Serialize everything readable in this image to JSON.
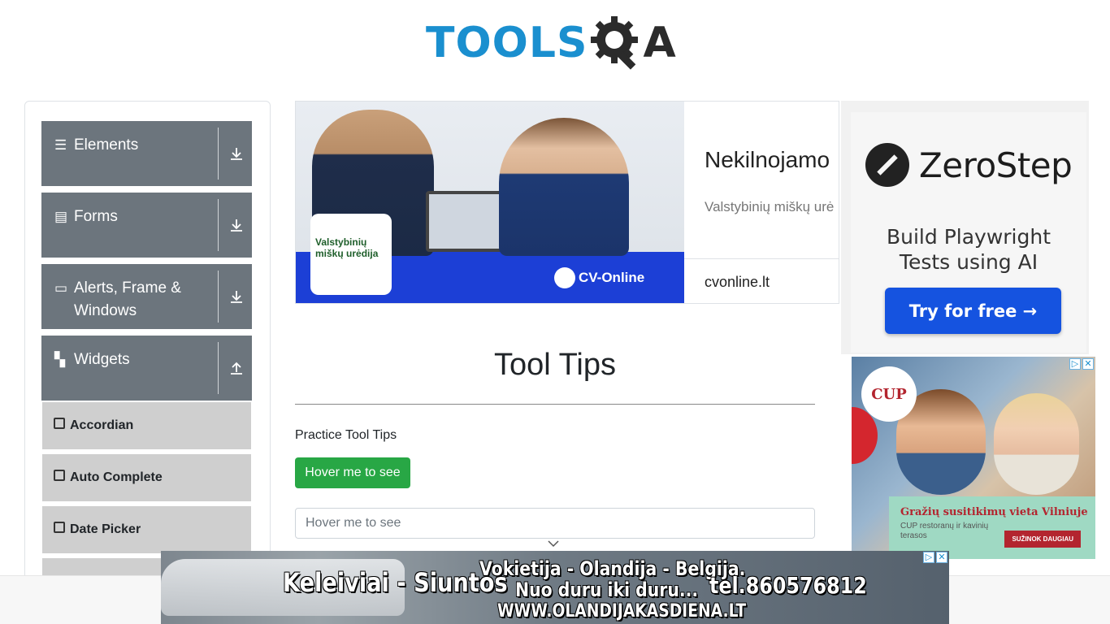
{
  "header": {
    "logo_text_left": "TOOLS",
    "logo_text_right": "A"
  },
  "sidebar": {
    "groups": [
      {
        "label": "Elements",
        "icon": "hamburger-icon",
        "state": "collapsed"
      },
      {
        "label": "Forms",
        "icon": "document-icon",
        "state": "collapsed"
      },
      {
        "label": "Alerts, Frame & Windows",
        "icon": "window-icon",
        "state": "collapsed"
      },
      {
        "label": "Widgets",
        "icon": "grid-icon",
        "state": "expanded"
      }
    ],
    "sub_items": [
      "Accordian",
      "Auto Complete",
      "Date Picker"
    ]
  },
  "banner_ad": {
    "title": "Nekilnojamo",
    "subtitle": "Valstybinių miškų urė",
    "site": "cvonline.lt",
    "logo_text": "Valstybinių miškų urėdija",
    "brand": "CV-Online"
  },
  "main": {
    "page_title": "Tool Tips",
    "practice_label": "Practice Tool Tips",
    "hover_button_label": "Hover me to see",
    "hover_input_placeholder": "Hover me to see"
  },
  "zerostep_ad": {
    "brand": "ZeroStep",
    "tagline_line1": "Build Playwright",
    "tagline_line2": "Tests using AI",
    "cta": "Try for free →"
  },
  "cup_ad": {
    "logo": "CUP",
    "title": "Gražių susitikimų vieta Vilniuje",
    "subtitle": "CUP restoranų ir kavinių terasos",
    "cta": "SUŽINOK DAUGIAU"
  },
  "bottom_ad": {
    "main": "Keleiviai - Siuntos",
    "route": "Vokietija - Olandija - Belgija.",
    "door": "Nuo duru iki duru...",
    "phone": "tel.860576812",
    "website": "WWW.OLANDIJAKASDIENA.LT"
  },
  "colors": {
    "brand_blue": "#1a8fcf",
    "sidebar_group": "#6c757d",
    "sidebar_sub": "#cfcfcf",
    "hover_button": "#28a745",
    "zerostep_button": "#1553e0"
  }
}
